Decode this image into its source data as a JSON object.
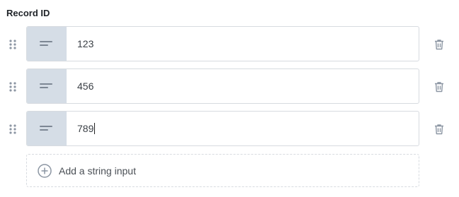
{
  "field_label": "Record ID",
  "inputs": [
    {
      "value": "123"
    },
    {
      "value": "456"
    },
    {
      "value": "789"
    }
  ],
  "add_button_label": "Add a string input",
  "icons": {
    "drag": "drag-handle-icon",
    "type": "text-type-icon",
    "delete": "trash-icon",
    "add": "plus-circle-icon"
  },
  "colors": {
    "type_box": "#d5dde6",
    "border": "#d7dbe0",
    "icon": "#8c96a3"
  }
}
